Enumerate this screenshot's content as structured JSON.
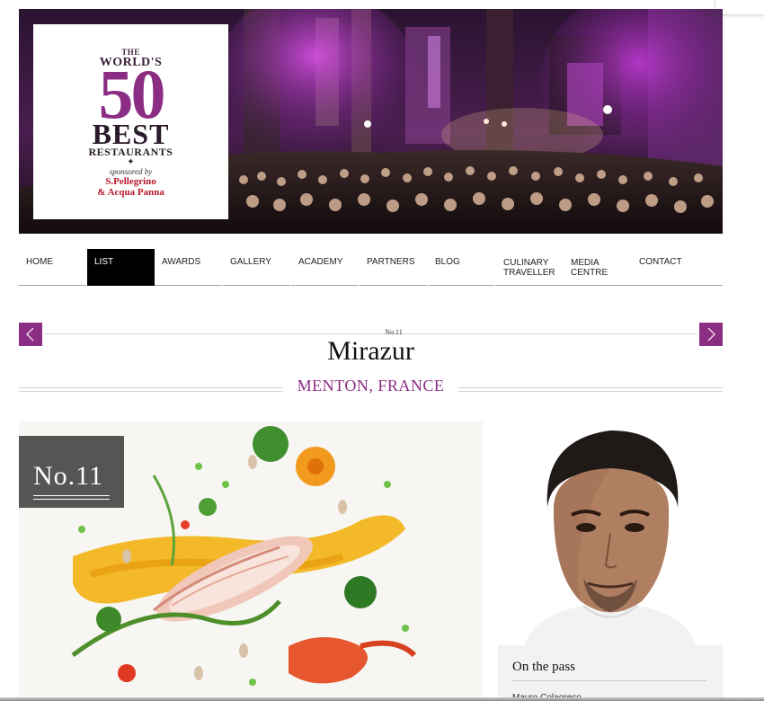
{
  "hero": {
    "logo": {
      "the": "THE",
      "worlds": "WORLD'S",
      "fifty": "50",
      "best": "BEST",
      "restaurants": "RESTAURANTS",
      "sponsored_by": "sponsored by",
      "sponsor_1": "S.Pellegrino",
      "sponsor_2": "& Acqua Panna"
    }
  },
  "nav": {
    "items": [
      {
        "label": "HOME"
      },
      {
        "label": "LIST",
        "active": true
      },
      {
        "label": "AWARDS"
      },
      {
        "label": "GALLERY"
      },
      {
        "label": "ACADEMY"
      },
      {
        "label": "PARTNERS"
      },
      {
        "label": "BLOG"
      },
      {
        "label": "CULINARY TRAVELLER"
      },
      {
        "label": "MEDIA CENTRE"
      },
      {
        "label": "CONTACT"
      }
    ]
  },
  "restaurant": {
    "rank_small": "No.11",
    "name": "Mirazur",
    "location": "MENTON, FRANCE",
    "rank_badge": "No.11"
  },
  "chef": {
    "section_title": "On the pass",
    "name": "Mauro Colagreco"
  },
  "colors": {
    "accent": "#8c2d84",
    "nav_active_bg": "#000000",
    "badge_bg": "#464646"
  },
  "icons": {
    "prev": "chevron-left-icon",
    "next": "chevron-right-icon"
  }
}
